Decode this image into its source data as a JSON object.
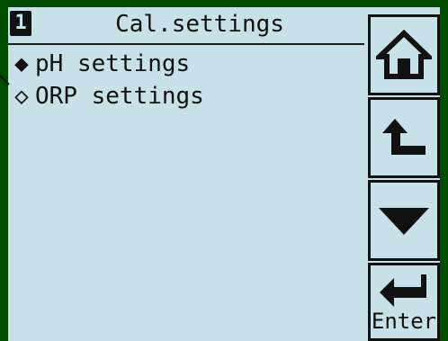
{
  "header": {
    "page_number": "1",
    "title": "Cal.settings"
  },
  "menu": {
    "items": [
      {
        "label": "pH settings",
        "marker": "◆",
        "selected": true
      },
      {
        "label": "ORP settings",
        "marker": "◇",
        "selected": false
      }
    ]
  },
  "buttons": {
    "home_icon": "home-icon",
    "back_icon": "return-arrow-icon",
    "down_icon": "down-triangle-icon",
    "enter_label": "Enter"
  },
  "colors": {
    "screen_background": "#c8e0e7",
    "frame_background": "#004d00",
    "foreground": "#111111"
  }
}
